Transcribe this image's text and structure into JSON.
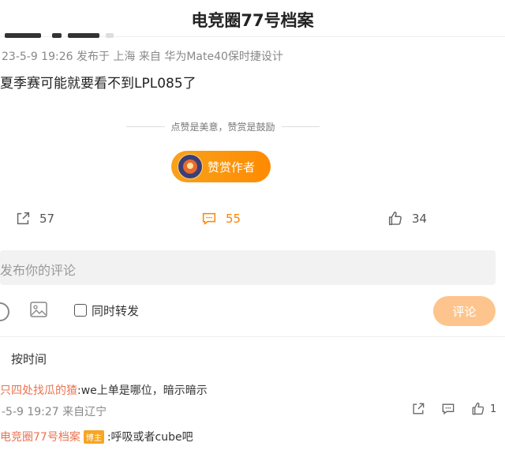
{
  "header": {
    "title": "电竞圈77号档案"
  },
  "post": {
    "meta": "23-5-9 19:26 发布于 上海 来自 华为Mate40保时捷设计",
    "body": "夏季赛可能就要看不到LPL085了"
  },
  "reward": {
    "divider_text": "点赞是美意，赞赏是鼓励",
    "button_label": "赞赏作者"
  },
  "actions": {
    "share_count": "57",
    "comment_count": "55",
    "like_count": "34"
  },
  "composer": {
    "placeholder": "发布你的评论",
    "repost_label": "同时转发",
    "submit_label": "评论"
  },
  "sort": {
    "label": "按时间"
  },
  "comments": [
    {
      "username": "只四处找瓜的猹",
      "text": ":we上单是哪位，暗示暗示",
      "meta": "-5-9 19:27 来自辽宁",
      "like_count": "1"
    },
    {
      "username": "电竞圈77号档案",
      "badge": "博主",
      "text": ":呼吸或者cube吧"
    }
  ],
  "colors": {
    "accent": "#ff8200",
    "username": "#eb7350",
    "reward_gradient_start": "#f7a21c",
    "reward_gradient_end": "#ff8a00",
    "submit_disabled": "#fdc58d"
  }
}
